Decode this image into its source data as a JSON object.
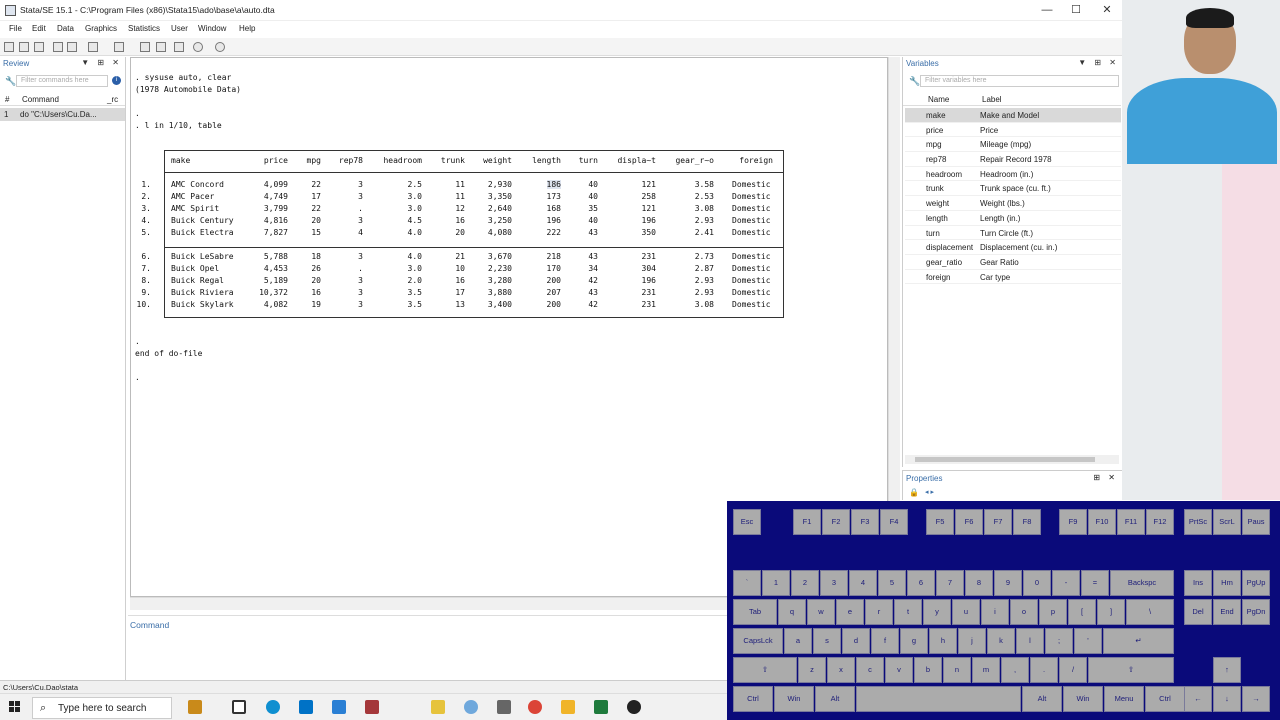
{
  "window": {
    "title": "Stata/SE 15.1 - C:\\Program Files (x86)\\Stata15\\ado\\base\\a\\auto.dta",
    "minimize": "—",
    "maximize": "☐",
    "close": "✕"
  },
  "menu": [
    "File",
    "Edit",
    "Data",
    "Graphics",
    "Statistics",
    "User",
    "Window",
    "Help"
  ],
  "review": {
    "title": "Review",
    "filter_placeholder": "Filter commands here",
    "col_hash": "#",
    "col_command": "Command",
    "col_rc": "_rc",
    "items": [
      {
        "num": "1",
        "command": "do \"C:\\Users\\Cu.Da..."
      }
    ]
  },
  "results": {
    "lines": [
      ". sysuse auto, clear",
      "(1978 Automobile Data)",
      ".",
      ". l in 1/10, table",
      ".",
      "end of do-file",
      "."
    ],
    "table": {
      "headers": [
        "make",
        "price",
        "mpg",
        "rep78",
        "headroom",
        "trunk",
        "weight",
        "length",
        "turn",
        "displa~t",
        "gear_r~o",
        "foreign"
      ],
      "rows": [
        [
          "1.",
          "AMC Concord",
          "4,099",
          "22",
          "3",
          "2.5",
          "11",
          "2,930",
          "186",
          "40",
          "121",
          "3.58",
          "Domestic"
        ],
        [
          "2.",
          "AMC Pacer",
          "4,749",
          "17",
          "3",
          "3.0",
          "11",
          "3,350",
          "173",
          "40",
          "258",
          "2.53",
          "Domestic"
        ],
        [
          "3.",
          "AMC Spirit",
          "3,799",
          "22",
          ".",
          "3.0",
          "12",
          "2,640",
          "168",
          "35",
          "121",
          "3.08",
          "Domestic"
        ],
        [
          "4.",
          "Buick Century",
          "4,816",
          "20",
          "3",
          "4.5",
          "16",
          "3,250",
          "196",
          "40",
          "196",
          "2.93",
          "Domestic"
        ],
        [
          "5.",
          "Buick Electra",
          "7,827",
          "15",
          "4",
          "4.0",
          "20",
          "4,080",
          "222",
          "43",
          "350",
          "2.41",
          "Domestic"
        ],
        [
          "6.",
          "Buick LeSabre",
          "5,788",
          "18",
          "3",
          "4.0",
          "21",
          "3,670",
          "218",
          "43",
          "231",
          "2.73",
          "Domestic"
        ],
        [
          "7.",
          "Buick Opel",
          "4,453",
          "26",
          ".",
          "3.0",
          "10",
          "2,230",
          "170",
          "34",
          "304",
          "2.87",
          "Domestic"
        ],
        [
          "8.",
          "Buick Regal",
          "5,189",
          "20",
          "3",
          "2.0",
          "16",
          "3,280",
          "200",
          "42",
          "196",
          "2.93",
          "Domestic"
        ],
        [
          "9.",
          "Buick Riviera",
          "10,372",
          "16",
          "3",
          "3.5",
          "17",
          "3,880",
          "207",
          "43",
          "231",
          "2.93",
          "Domestic"
        ],
        [
          "10.",
          "Buick Skylark",
          "4,082",
          "19",
          "3",
          "3.5",
          "13",
          "3,400",
          "200",
          "42",
          "231",
          "3.08",
          "Domestic"
        ]
      ]
    }
  },
  "command_panel": {
    "title": "Command"
  },
  "variables": {
    "title": "Variables",
    "filter_placeholder": "Filter variables here",
    "col_name": "Name",
    "col_label": "Label",
    "items": [
      {
        "name": "make",
        "label": "Make and Model"
      },
      {
        "name": "price",
        "label": "Price"
      },
      {
        "name": "mpg",
        "label": "Mileage (mpg)"
      },
      {
        "name": "rep78",
        "label": "Repair Record 1978"
      },
      {
        "name": "headroom",
        "label": "Headroom (in.)"
      },
      {
        "name": "trunk",
        "label": "Trunk space (cu. ft.)"
      },
      {
        "name": "weight",
        "label": "Weight (lbs.)"
      },
      {
        "name": "length",
        "label": "Length (in.)"
      },
      {
        "name": "turn",
        "label": "Turn Circle (ft.)"
      },
      {
        "name": "displacement",
        "label": "Displacement (cu. in.)"
      },
      {
        "name": "gear_ratio",
        "label": "Gear Ratio"
      },
      {
        "name": "foreign",
        "label": "Car type"
      }
    ]
  },
  "properties": {
    "title": "Properties"
  },
  "status": {
    "path": "C:\\Users\\Cu.Dao\\stata"
  },
  "taskbar": {
    "search_placeholder": "Type here to search"
  },
  "osk": {
    "rows": [
      [
        "Esc",
        "F1",
        "F2",
        "F3",
        "F4",
        "F5",
        "F6",
        "F7",
        "F8",
        "F9",
        "F10",
        "F11",
        "F12",
        "PrtSc",
        "ScrL",
        "Paus"
      ],
      [
        "`",
        "1",
        "2",
        "3",
        "4",
        "5",
        "6",
        "7",
        "8",
        "9",
        "0",
        "-",
        "=",
        "Backspc",
        "Ins",
        "Hm",
        "PgUp"
      ],
      [
        "Tab",
        "q",
        "w",
        "e",
        "r",
        "t",
        "y",
        "u",
        "i",
        "o",
        "p",
        "[",
        "]",
        "\\",
        "Del",
        "End",
        "PgDn"
      ],
      [
        "CapsLck",
        "a",
        "s",
        "d",
        "f",
        "g",
        "h",
        "j",
        "k",
        "l",
        ";",
        "'",
        "↵"
      ],
      [
        "⇧",
        "z",
        "x",
        "c",
        "v",
        "b",
        "n",
        "m",
        ",",
        ".",
        "/",
        "⇧",
        "↑"
      ],
      [
        "Ctrl",
        "Win",
        "Alt",
        "",
        "Alt",
        "Win",
        "Menu",
        "Ctrl",
        "←",
        "↓",
        "→"
      ]
    ]
  }
}
